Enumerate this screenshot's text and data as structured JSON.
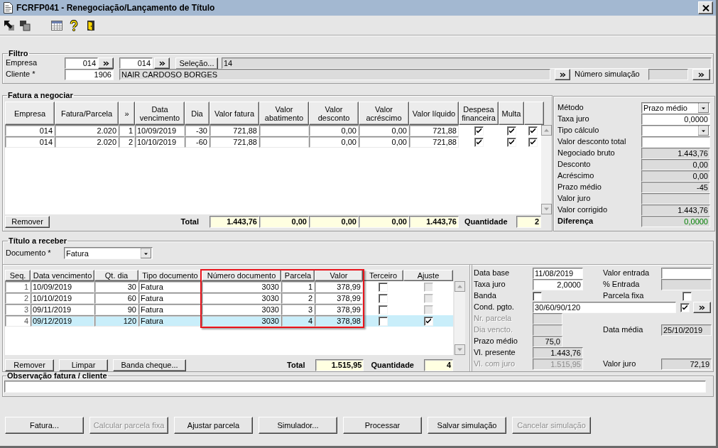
{
  "window": {
    "title": "FCRFP041 - Renegociação/Lançamento de Título"
  },
  "filter": {
    "title": "Filtro",
    "company_label": "Empresa",
    "company_from": "014",
    "company_to": "014",
    "selection_button": "Seleção...",
    "selection": "14",
    "client_label": "Cliente *",
    "client_code": "1906",
    "client_name": "NAIR CARDOSO BORGES",
    "simulation_label": "Número simulação"
  },
  "invoices": {
    "title": "Fatura a negociar",
    "columns": [
      "Empresa",
      "Fatura/Parcela",
      "»",
      "Data vencimento",
      "Dia",
      "Valor fatura",
      "Valor abatimento",
      "Valor desconto",
      "Valor acréscimo",
      "Valor líquido",
      "Despesa financeira",
      "Multa"
    ],
    "rows": [
      {
        "cells": [
          "014",
          "2.020",
          "1",
          "10/09/2019",
          "-30",
          "721,88",
          null,
          "0,00",
          "0,00",
          "721,88"
        ],
        "checked": [
          true,
          true,
          true
        ]
      },
      {
        "cells": [
          "014",
          "2.020",
          "2",
          "10/10/2019",
          "-60",
          "721,88",
          null,
          "0,00",
          "0,00",
          "721,88"
        ],
        "checked": [
          true,
          true,
          true
        ]
      }
    ],
    "remove_button": "Remover",
    "total_label": "Total",
    "totals": [
      "1.443,76",
      "0,00",
      "0,00",
      "0,00",
      "1.443,76"
    ],
    "quantity_label": "Quantidade",
    "quantity": "2"
  },
  "summary": [
    {
      "label": "Método",
      "kind": "select",
      "value": "Prazo médio"
    },
    {
      "label": "Taxa juro",
      "kind": "input",
      "value": "0,0000"
    },
    {
      "label": "Tipo cálculo",
      "kind": "select"
    },
    {
      "label": "Valor desconto total",
      "kind": "input"
    },
    {
      "label": "Negociado bruto",
      "kind": "readonly",
      "value": "1.443,76"
    },
    {
      "label": "Desconto",
      "kind": "readonly",
      "value": "0,00"
    },
    {
      "label": "Acréscimo",
      "kind": "readonly",
      "value": "0,00"
    },
    {
      "label": "Prazo médio",
      "kind": "readonly",
      "value": "-45"
    },
    {
      "label": "Valor juro",
      "kind": "readonly"
    },
    {
      "label": "Valor corrigido",
      "kind": "readonly",
      "value": "1.443,76"
    },
    {
      "label": "Diferença",
      "kind": "result",
      "value": "0,0000"
    }
  ],
  "receivables": {
    "title": "Título a receber",
    "document_label": "Documento *",
    "document": "Fatura",
    "columns": [
      {
        "label": "Seq.",
        "highlighted": false
      },
      {
        "label": "Data vencimento",
        "highlighted": false
      },
      {
        "label": "Qt. dia",
        "highlighted": false
      },
      {
        "label": "Tipo documento",
        "highlighted": false
      },
      {
        "label": "Número documento",
        "highlighted": true
      },
      {
        "label": "Parcela",
        "highlighted": true
      },
      {
        "label": "Valor",
        "highlighted": true
      },
      {
        "label": "Terceiro",
        "highlighted": false
      },
      {
        "label": "Ajuste",
        "highlighted": false
      }
    ],
    "rows": [
      {
        "selected": false,
        "cells": [
          "1",
          "10/09/2019",
          "30",
          "Fatura",
          "3030",
          "1",
          "378,99"
        ],
        "checks": [
          {
            "checked": false,
            "disabled": false
          },
          {
            "checked": false,
            "disabled": true
          }
        ]
      },
      {
        "selected": false,
        "cells": [
          "2",
          "10/10/2019",
          "60",
          "Fatura",
          "3030",
          "2",
          "378,99"
        ],
        "checks": [
          {
            "checked": false,
            "disabled": false
          },
          {
            "checked": false,
            "disabled": true
          }
        ]
      },
      {
        "selected": false,
        "cells": [
          "3",
          "09/11/2019",
          "90",
          "Fatura",
          "3030",
          "3",
          "378,99"
        ],
        "checks": [
          {
            "checked": false,
            "disabled": false
          },
          {
            "checked": false,
            "disabled": true
          }
        ]
      },
      {
        "selected": true,
        "cells": [
          "4",
          "09/12/2019",
          "120",
          "Fatura",
          "3030",
          "4",
          "378,98"
        ],
        "checks": [
          {
            "checked": false,
            "disabled": false
          },
          {
            "checked": true,
            "disabled": false
          }
        ]
      }
    ],
    "buttons": [
      "Remover",
      "Limpar",
      "Banda cheque..."
    ],
    "total_label": "Total",
    "total": "1.515,95",
    "quantity_label": "Quantidade",
    "quantity": "4"
  },
  "installments": [
    {
      "label": "Data base",
      "disabled": false,
      "field": {
        "kind": "date",
        "value": "11/08/2019"
      },
      "side": {
        "label": "Valor entrada",
        "field": {
          "kind": "number"
        }
      }
    },
    {
      "label": "Taxa juro",
      "disabled": false,
      "field": {
        "kind": "number",
        "value": "2,0000"
      },
      "side": {
        "label": "% Entrada",
        "field": {
          "kind": "readonly"
        }
      }
    },
    {
      "label": "Banda",
      "disabled": false,
      "field": {
        "kind": "checkbox",
        "checked": false
      },
      "side": {
        "label": "Parcela fixa",
        "field": {
          "kind": "checkbox",
          "checked": false
        }
      }
    },
    {
      "label": "Cond. pgto.",
      "disabled": false,
      "field": {
        "kind": "text",
        "value": "30/60/90/120"
      },
      "side": {
        "field": {
          "kind": "checkbox",
          "checked": true
        },
        "lookup": true
      }
    },
    {
      "label": "Nr. parcela",
      "disabled": true,
      "field": {
        "kind": "stub"
      }
    },
    {
      "label": "Dia vencto.",
      "disabled": true,
      "field": {
        "kind": "stub"
      },
      "side": {
        "label": "Data média",
        "field": {
          "kind": "shown_date",
          "value": "25/10/2019"
        }
      }
    },
    {
      "label": "Prazo médio",
      "disabled": false,
      "field": {
        "kind": "stub",
        "value": "75,0"
      }
    },
    {
      "label": "Vl. presente",
      "disabled": false,
      "field": {
        "kind": "readonly",
        "value": "1.443,76"
      }
    },
    {
      "label": "Vl. com juro",
      "disabled": true,
      "field": {
        "kind": "readonly",
        "value": "1.515,95"
      },
      "side": {
        "label": "Valor juro",
        "field": {
          "kind": "readonly",
          "value": "72,19"
        }
      }
    }
  ],
  "notes": {
    "title": "Observação fatura / cliente"
  },
  "actions": [
    {
      "label": "Fatura...",
      "disabled": false
    },
    {
      "label": "Calcular parcela fixa",
      "disabled": true
    },
    {
      "label": "Ajustar parcela",
      "disabled": false
    },
    {
      "label": "Simulador...",
      "disabled": false
    },
    {
      "label": "Processar",
      "disabled": false
    },
    {
      "label": "Salvar simulação",
      "disabled": false
    },
    {
      "label": "Cancelar simulação",
      "disabled": true
    }
  ]
}
